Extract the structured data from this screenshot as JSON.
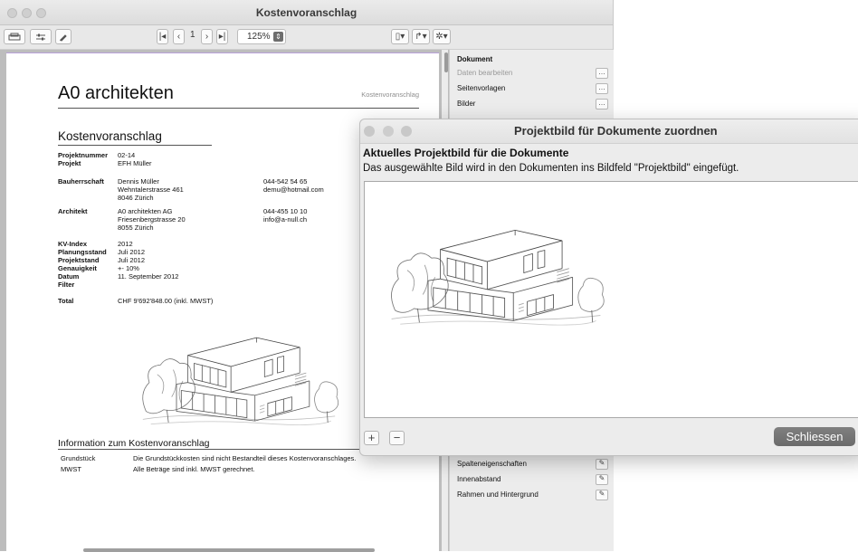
{
  "window": {
    "title": "Kostenvoranschlag"
  },
  "toolbar": {
    "page_number": "1",
    "zoom": "125%"
  },
  "document": {
    "company": "A0 architekten",
    "header_right": "Kostenvoranschlag",
    "title": "Kostenvoranschlag",
    "projektnummer": {
      "label": "Projektnummer",
      "value": "02-14"
    },
    "projekt": {
      "label": "Projekt",
      "value": "EFH Müller"
    },
    "bauherrschaft": {
      "label": "Bauherrschaft",
      "address": [
        "Dennis Müller",
        "Wehntalerstrasse 461",
        "8046 Zürich"
      ],
      "phone": "044-542 54 65",
      "email": "demu@hotmail.com"
    },
    "architekt": {
      "label": "Architekt",
      "address": [
        "A0 architekten AG",
        "Friesenbergstrasse 20",
        "8055 Zürich"
      ],
      "phone": "044-455 10 10",
      "email": "info@a-null.ch"
    },
    "details": [
      {
        "label": "KV-Index",
        "value": "2012"
      },
      {
        "label": "Planungsstand",
        "value": "Juli 2012"
      },
      {
        "label": "Projektstand",
        "value": "Juli 2012"
      },
      {
        "label": "Genauigkeit",
        "value": "+- 10%"
      },
      {
        "label": "Datum",
        "value": "11. September 2012"
      },
      {
        "label": "Filter",
        "value": ""
      }
    ],
    "total": {
      "label": "Total",
      "value": "CHF 9'692'848.00  (inkl. MWST)"
    },
    "info_title": "Information zum Kostenvoranschlag",
    "info_rows": [
      {
        "label": "Grundstück",
        "value": "Die Grundstückkosten sind nicht Bestandteil dieses Kostenvoranschlages."
      },
      {
        "label": "MWST",
        "value": "Alle Beträge sind inkl. MWST gerechnet."
      }
    ]
  },
  "side_panel": {
    "section": "Dokument",
    "items": [
      {
        "label": "Daten bearbeiten",
        "disabled": true
      },
      {
        "label": "Seitenvorlagen",
        "disabled": false
      },
      {
        "label": "Bilder",
        "disabled": false
      }
    ],
    "bottom_items": [
      {
        "label": "Spalteneigenschaften"
      },
      {
        "label": "Innenabstand"
      },
      {
        "label": "Rahmen und Hintergrund"
      }
    ]
  },
  "dialog": {
    "title": "Projektbild für Dokumente zuordnen",
    "heading": "Aktuelles Projektbild für die Dokumente",
    "description": "Das ausgewählte Bild wird in den Dokumenten ins Bildfeld \"Projektbild\" eingefügt.",
    "add_label": "+",
    "remove_label": "−",
    "close_label": "Schliessen"
  },
  "colors": {
    "dot_red": "#d4d4d4",
    "accent_line": "#b9a3d9",
    "close_button": "#747474"
  }
}
